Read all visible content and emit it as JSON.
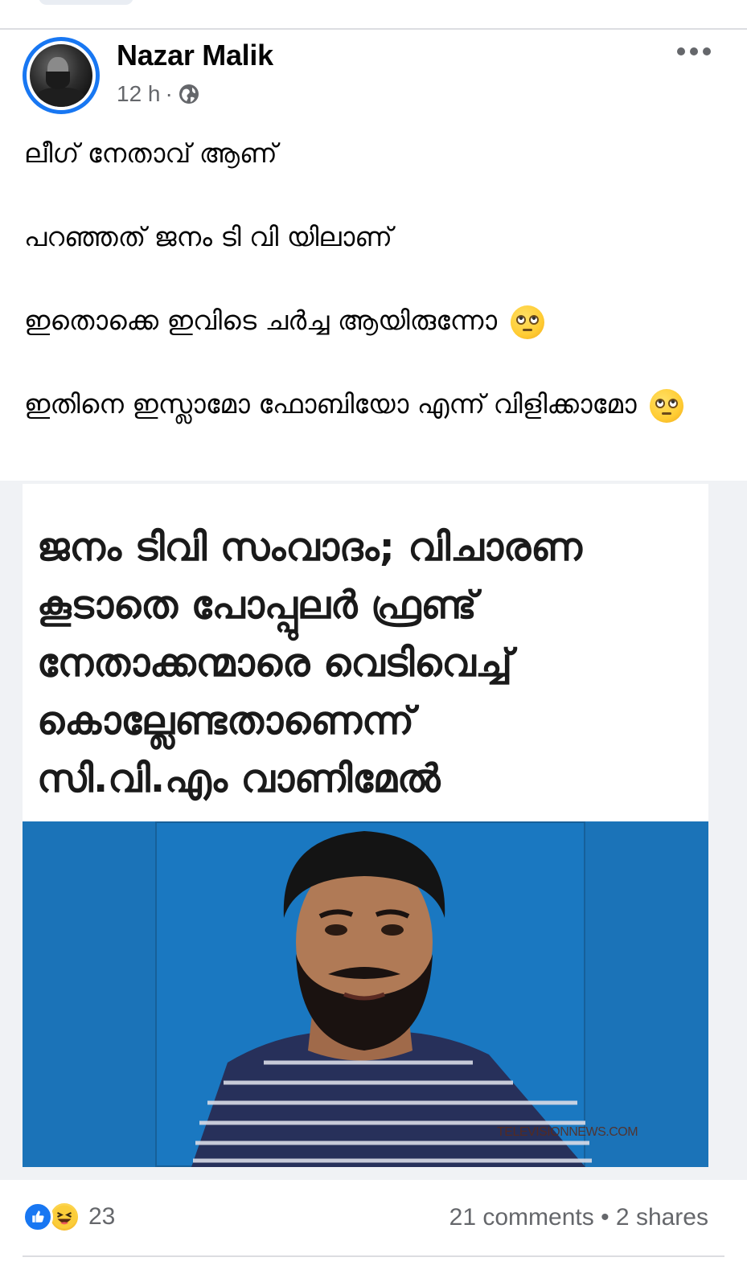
{
  "post": {
    "author": "Nazar Malik",
    "time": "12 h",
    "separator": "·",
    "privacy_icon": "globe-icon",
    "more_icon": "more-options-icon",
    "paragraphs": [
      "ലീഗ് നേതാവ് ആണ്",
      "പറഞ്ഞത് ജനം ടി വി യിലാണ്",
      "ഇതൊക്കെ ഇവിടെ ചർച്ച ആയിരുന്നോ",
      "ഇതിനെ ഇസ്ലാമോ ഫോബിയോ എന്ന് വിളിക്കാമോ"
    ],
    "emoji_icon": "face-with-rolling-eyes-icon"
  },
  "card": {
    "headline_lines": [
      "ജനം ടിവി സംവാദം; വിചാരണ",
      "കൂടാതെ പോപ്പുലർ ഫ്രണ്ട്",
      "നേതാക്കന്മാരെ വെടിവെച്ച്",
      "കൊല്ലേണ്ടതാണെന്ന്",
      "സി.വി.എം വാണിമേൽ"
    ],
    "watermark": "TELEVISIONNEWS.COM"
  },
  "footer": {
    "reaction_icons": [
      "like-icon",
      "haha-icon"
    ],
    "reaction_count": "23",
    "comments": "21 comments",
    "dot": "•",
    "shares": "2 shares"
  },
  "colors": {
    "accent": "#1877f2",
    "secondary_text": "#65676b",
    "photo_bg": "#1a78c1"
  }
}
